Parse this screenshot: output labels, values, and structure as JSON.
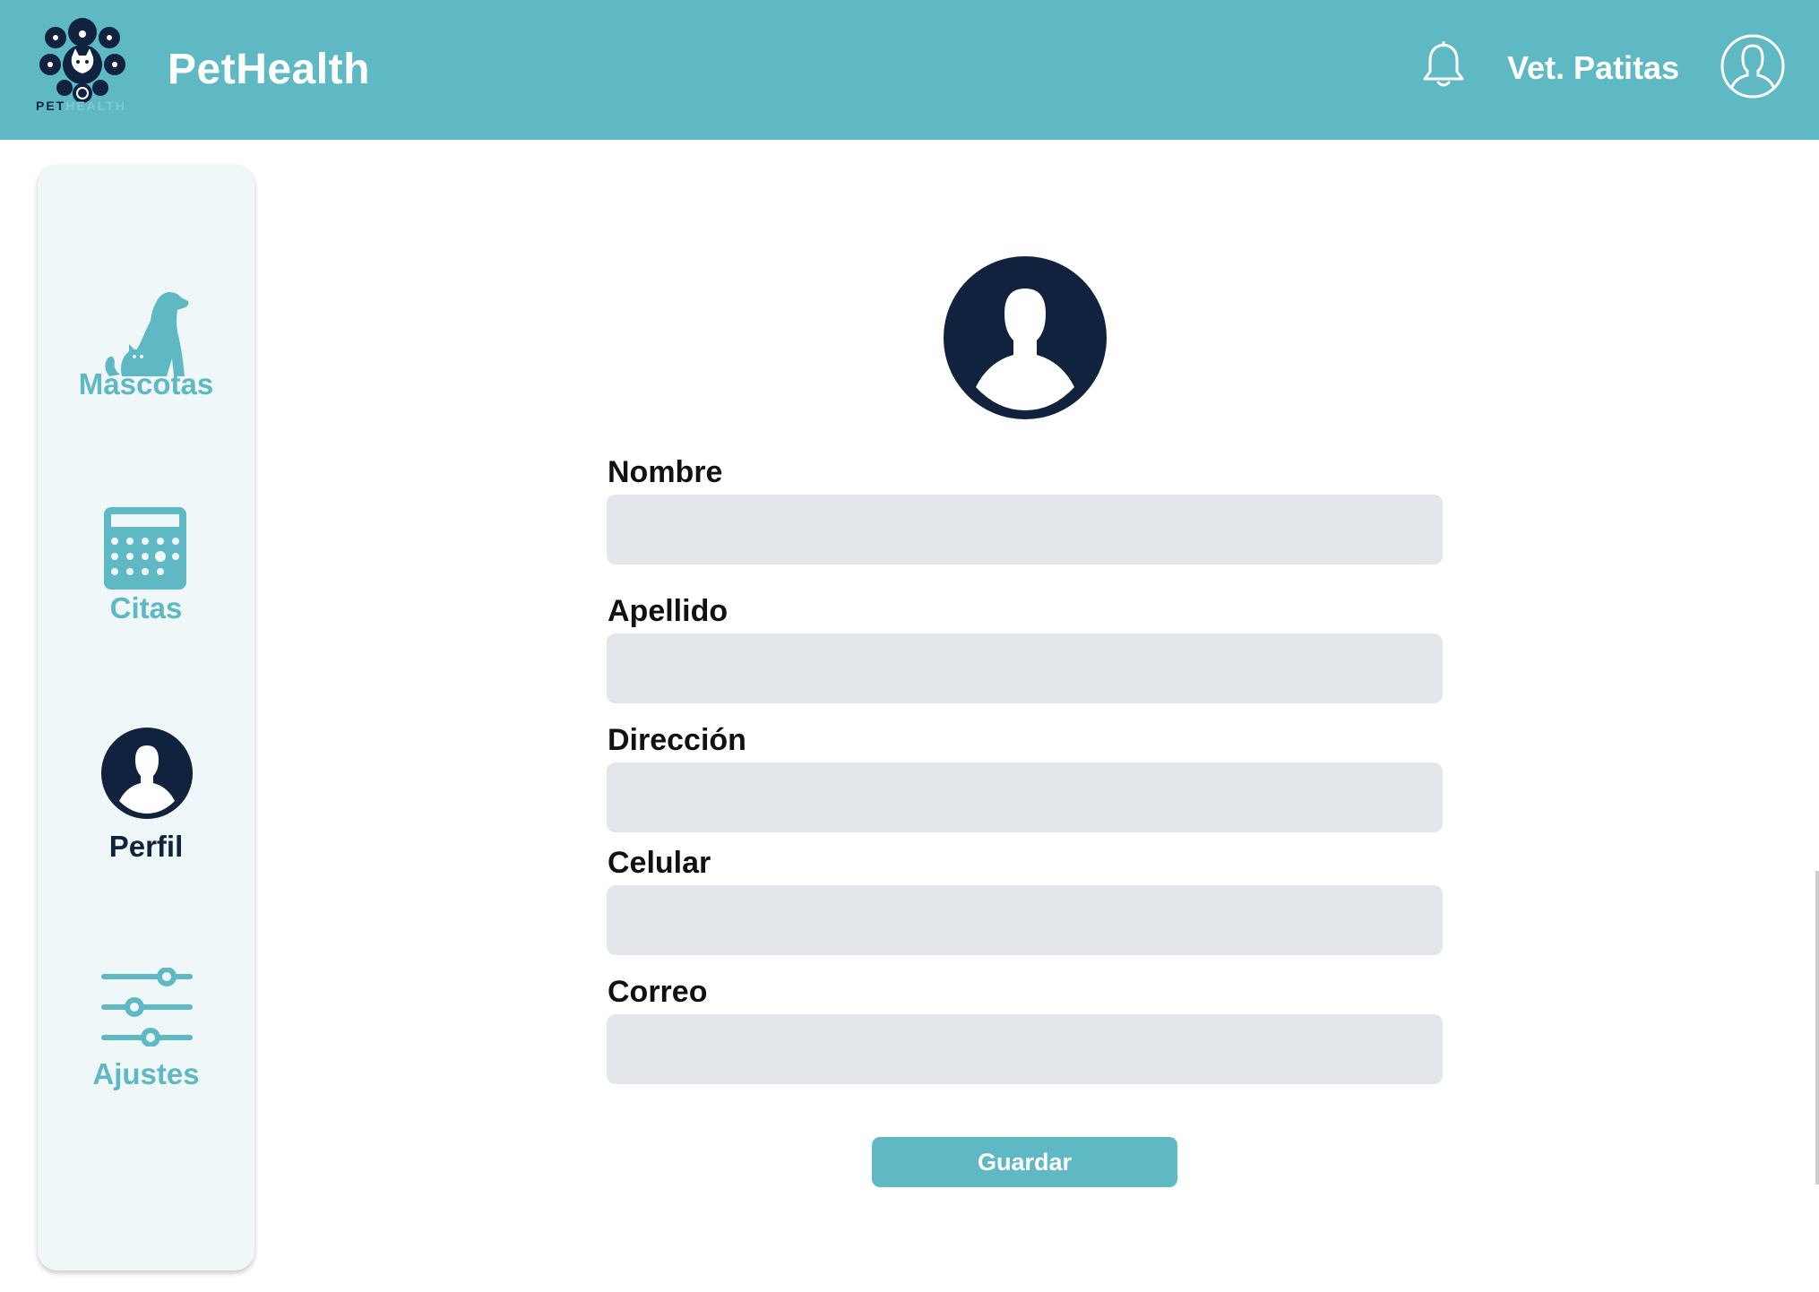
{
  "header": {
    "logo_text_a": "PET",
    "logo_text_b": "HEALTH",
    "title": "PetHealth",
    "bell_icon": "bell-icon",
    "user_name": "Vet. Patitas",
    "avatar_icon": "user-circle-icon"
  },
  "sidebar": {
    "items": [
      {
        "label": "Mascotas",
        "icon": "pets-icon",
        "active": false
      },
      {
        "label": "Citas",
        "icon": "calendar-icon",
        "active": false
      },
      {
        "label": "Perfil",
        "icon": "profile-icon",
        "active": true
      },
      {
        "label": "Ajustes",
        "icon": "sliders-icon",
        "active": false
      }
    ]
  },
  "form": {
    "avatar_icon": "profile-avatar-icon",
    "fields": [
      {
        "label": "Nombre",
        "value": "",
        "placeholder": ""
      },
      {
        "label": "Apellido",
        "value": "",
        "placeholder": ""
      },
      {
        "label": "Dirección",
        "value": "",
        "placeholder": ""
      },
      {
        "label": "Celular",
        "value": "",
        "placeholder": ""
      },
      {
        "label": "Correo",
        "value": "",
        "placeholder": ""
      }
    ],
    "save_label": "Guardar"
  },
  "colors": {
    "accent": "#5FB9C5",
    "navy": "#10223D",
    "sidebar_bg": "#EFF7F8",
    "input_bg": "#E3E6EA"
  }
}
